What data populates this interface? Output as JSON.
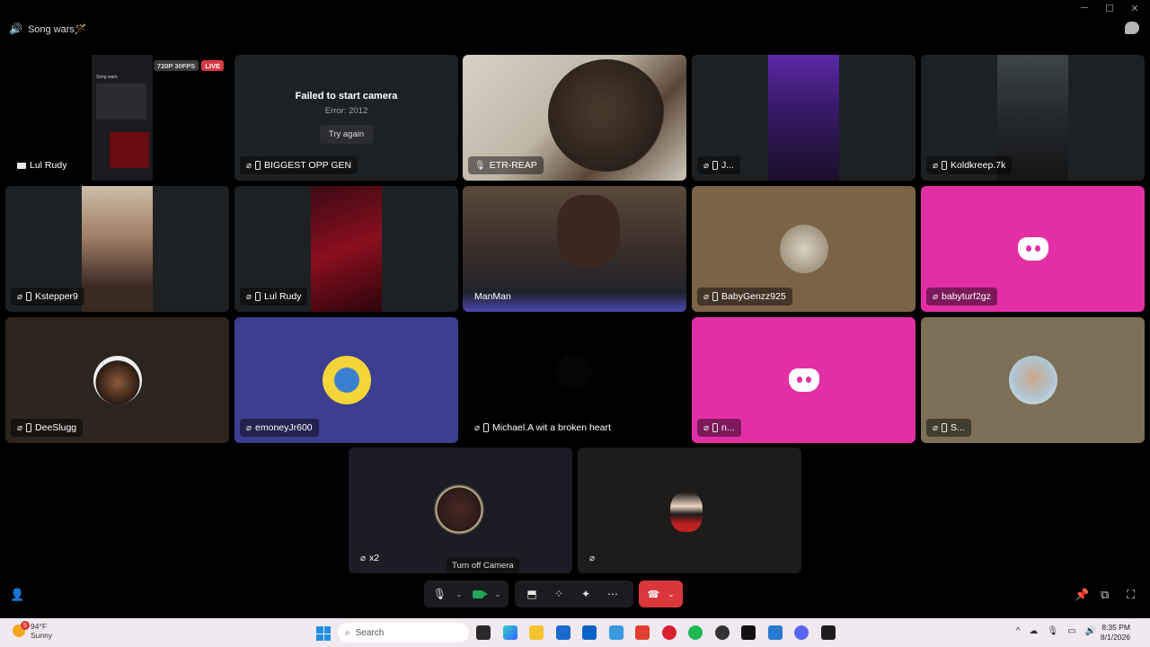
{
  "window": {
    "minimize": "─",
    "maximize": "☐",
    "close": "✕"
  },
  "channel": {
    "name": "Song wars🪄"
  },
  "stream": {
    "resolution": "720P 30FPS",
    "live": "LIVE",
    "mini_title": "Song wars"
  },
  "error": {
    "title": "Failed to start camera",
    "code": "Error: 2012",
    "retry": "Try again"
  },
  "participants": [
    {
      "name": "Lul Rudy"
    },
    {
      "name": "BIGGEST OPP GEN"
    },
    {
      "name": "ETR-REAP"
    },
    {
      "name": "J..."
    },
    {
      "name": "Koldkreep.7k"
    },
    {
      "name": "Kstepper9"
    },
    {
      "name": "Lul Rudy"
    },
    {
      "name": "ManMan"
    },
    {
      "name": "BabyGenzz925"
    },
    {
      "name": "babyturf2gz"
    },
    {
      "name": "DeeSlugg"
    },
    {
      "name": "emoneyJr600"
    },
    {
      "name": "Michael.A wit a broken heart"
    },
    {
      "name": "n..."
    },
    {
      "name": "S..."
    },
    {
      "name": "x2"
    },
    {
      "name": ""
    }
  ],
  "controls": {
    "tooltip": "Turn off Camera"
  },
  "taskbar": {
    "weather_temp": "94°F",
    "weather_desc": "Sunny",
    "weather_badge": "5",
    "search_placeholder": "Search",
    "time": "8:35 PM",
    "date": "8/1/2026"
  },
  "colors": {
    "discord_pink": "#e32fa5",
    "blurple_tile": "#3c3f8f",
    "leave_red": "#da373c",
    "camera_green": "#23a55a"
  },
  "icons": [
    "speaker-icon",
    "chat-icon",
    "mic-muted-icon",
    "mobile-icon",
    "screen-icon",
    "discord-icon",
    "mic-icon",
    "chevron-down-icon",
    "camera-icon",
    "share-screen-icon",
    "activities-icon",
    "soundboard-icon",
    "more-icon",
    "hang-up-icon",
    "pin-icon",
    "popout-icon",
    "fullscreen-icon",
    "add-user-icon",
    "windows-start-icon",
    "search-icon"
  ]
}
